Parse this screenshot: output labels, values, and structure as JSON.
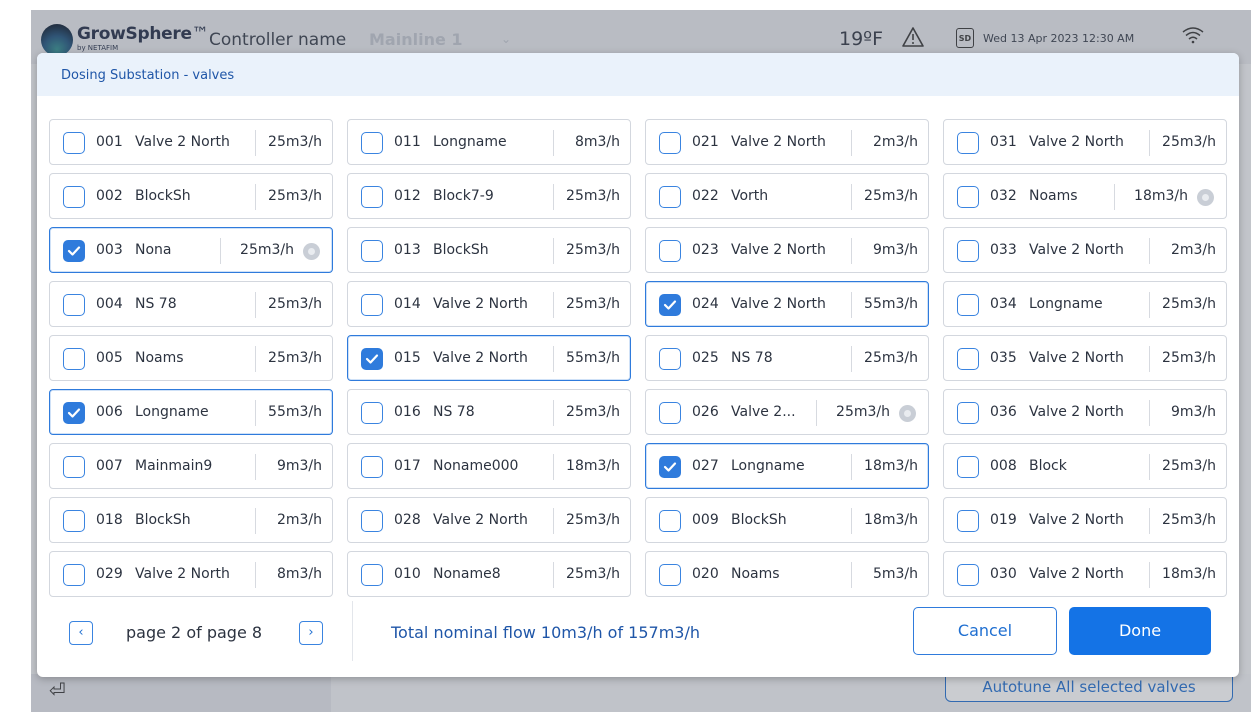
{
  "header": {
    "brand": "GrowSphere",
    "brand_suffix": "™",
    "brand_sub": "by NETAFIM",
    "controller_label": "Controller name",
    "mainline": "Mainline 1",
    "temperature": "19ºF",
    "datetime": "Wed 13 Apr 2023  12:30 AM",
    "sd_label": "SD"
  },
  "modal": {
    "title": "Dosing Substation - valves"
  },
  "valves": [
    {
      "num": "001",
      "name": "Valve 2 North",
      "flow": "25m3/h",
      "selected": false,
      "dot": false
    },
    {
      "num": "002",
      "name": "BlockSh",
      "flow": "25m3/h",
      "selected": false,
      "dot": false
    },
    {
      "num": "003",
      "name": "Nona",
      "flow": "25m3/h",
      "selected": true,
      "dot": true
    },
    {
      "num": "004",
      "name": "NS 78",
      "flow": "25m3/h",
      "selected": false,
      "dot": false
    },
    {
      "num": "005",
      "name": "Noams",
      "flow": "25m3/h",
      "selected": false,
      "dot": false
    },
    {
      "num": "006",
      "name": "Longname",
      "flow": "55m3/h",
      "selected": true,
      "dot": false
    },
    {
      "num": "007",
      "name": "Mainmain9",
      "flow": "9m3/h",
      "selected": false,
      "dot": false
    },
    {
      "num": "018",
      "name": "BlockSh",
      "flow": "2m3/h",
      "selected": false,
      "dot": false
    },
    {
      "num": "029",
      "name": "Valve 2 North",
      "flow": "8m3/h",
      "selected": false,
      "dot": false
    },
    {
      "num": "011",
      "name": "Longname",
      "flow": "8m3/h",
      "selected": false,
      "dot": false
    },
    {
      "num": "012",
      "name": "Block7-9",
      "flow": "25m3/h",
      "selected": false,
      "dot": false
    },
    {
      "num": "013",
      "name": "BlockSh",
      "flow": "25m3/h",
      "selected": false,
      "dot": false
    },
    {
      "num": "014",
      "name": "Valve 2 North",
      "flow": "25m3/h",
      "selected": false,
      "dot": false
    },
    {
      "num": "015",
      "name": "Valve 2 North",
      "flow": "55m3/h",
      "selected": true,
      "dot": false
    },
    {
      "num": "016",
      "name": "NS 78",
      "flow": "25m3/h",
      "selected": false,
      "dot": false
    },
    {
      "num": "017",
      "name": "Noname000",
      "flow": "18m3/h",
      "selected": false,
      "dot": false
    },
    {
      "num": "028",
      "name": "Valve 2 North",
      "flow": "25m3/h",
      "selected": false,
      "dot": false
    },
    {
      "num": "010",
      "name": "Noname8",
      "flow": "25m3/h",
      "selected": false,
      "dot": false
    },
    {
      "num": "021",
      "name": "Valve 2 North",
      "flow": "2m3/h",
      "selected": false,
      "dot": false
    },
    {
      "num": "022",
      "name": "Vorth",
      "flow": "25m3/h",
      "selected": false,
      "dot": false
    },
    {
      "num": "023",
      "name": "Valve 2 North",
      "flow": "9m3/h",
      "selected": false,
      "dot": false
    },
    {
      "num": "024",
      "name": "Valve 2 North",
      "flow": "55m3/h",
      "selected": true,
      "dot": false
    },
    {
      "num": "025",
      "name": "NS 78",
      "flow": "25m3/h",
      "selected": false,
      "dot": false
    },
    {
      "num": "026",
      "name": "Valve 2...",
      "flow": "25m3/h",
      "selected": false,
      "dot": true
    },
    {
      "num": "027",
      "name": "Longname",
      "flow": "18m3/h",
      "selected": true,
      "dot": false
    },
    {
      "num": "009",
      "name": "BlockSh",
      "flow": "18m3/h",
      "selected": false,
      "dot": false
    },
    {
      "num": "020",
      "name": "Noams",
      "flow": "5m3/h",
      "selected": false,
      "dot": false
    },
    {
      "num": "031",
      "name": "Valve 2 North",
      "flow": "25m3/h",
      "selected": false,
      "dot": false
    },
    {
      "num": "032",
      "name": "Noams",
      "flow": "18m3/h",
      "selected": false,
      "dot": true
    },
    {
      "num": "033",
      "name": "Valve 2 North",
      "flow": "2m3/h",
      "selected": false,
      "dot": false
    },
    {
      "num": "034",
      "name": "Longname",
      "flow": "25m3/h",
      "selected": false,
      "dot": false
    },
    {
      "num": "035",
      "name": "Valve 2 North",
      "flow": "25m3/h",
      "selected": false,
      "dot": false
    },
    {
      "num": "036",
      "name": "Valve 2 North",
      "flow": "9m3/h",
      "selected": false,
      "dot": false
    },
    {
      "num": "008",
      "name": "Block",
      "flow": "25m3/h",
      "selected": false,
      "dot": false
    },
    {
      "num": "019",
      "name": "Valve 2 North",
      "flow": "25m3/h",
      "selected": false,
      "dot": false
    },
    {
      "num": "030",
      "name": "Valve 2 North",
      "flow": "18m3/h",
      "selected": false,
      "dot": false
    }
  ],
  "footer": {
    "prev": "‹",
    "page_label": "page 2 of page 8",
    "next": "›",
    "total_flow": "Total nominal flow 10m3/h of 157m3/h",
    "cancel_label": "Cancel",
    "done_label": "Done"
  },
  "background": {
    "autotune_label": "Autotune All selected valves",
    "exit_icon": "exit-icon"
  },
  "colors": {
    "accent": "#1473e6",
    "title": "#1f56a8"
  }
}
